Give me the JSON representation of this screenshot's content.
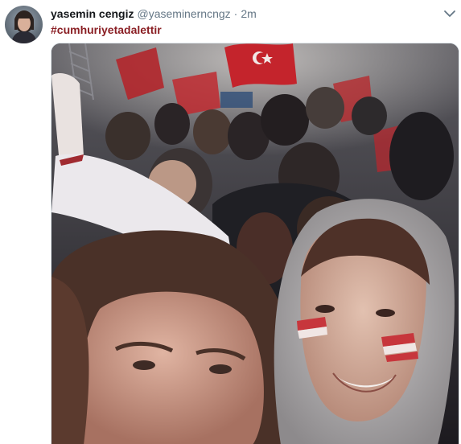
{
  "tweet": {
    "fullname": "yasemin cengiz",
    "username": "@yaseminerncngz",
    "separator": "·",
    "timestamp": "2m",
    "hashtag": "#cumhuriyetadalettir",
    "avatar_icon": "user-avatar-photo",
    "caret_icon": "chevron-down-icon"
  },
  "colors": {
    "hashtag": "#8a1f24",
    "name": "#14171a",
    "meta": "#657786",
    "border": "#e1e8ed"
  }
}
